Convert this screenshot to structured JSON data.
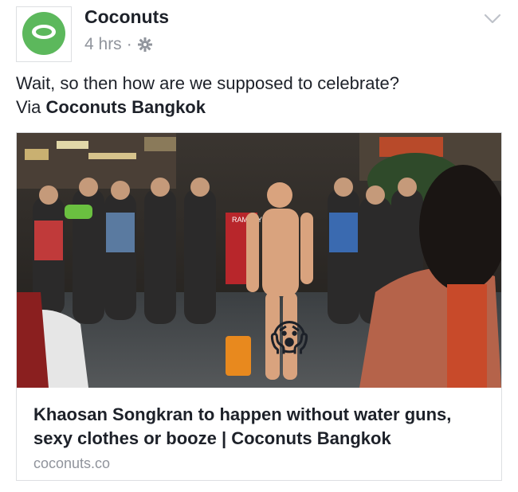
{
  "post": {
    "page_name": "Coconuts",
    "timestamp": "4 hrs",
    "separator": "·",
    "audience_icon": "gear-icon",
    "menu_icon": "chevron-down-icon",
    "text_line1": "Wait, so then how are we supposed to celebrate?",
    "text_via_prefix": "Via ",
    "text_via_page": "Coconuts Bangkok"
  },
  "link": {
    "title": "Khaosan Songkran to happen without water guns, sexy clothes or booze | Coconuts Bangkok",
    "domain": "coconuts.co",
    "image_shirt_text": "RAMSEY",
    "image_emoji": "😱"
  },
  "colors": {
    "brand_green": "#5cb85c",
    "text_primary": "#1d2129",
    "text_secondary": "#90949c",
    "border": "#dddfe2"
  }
}
